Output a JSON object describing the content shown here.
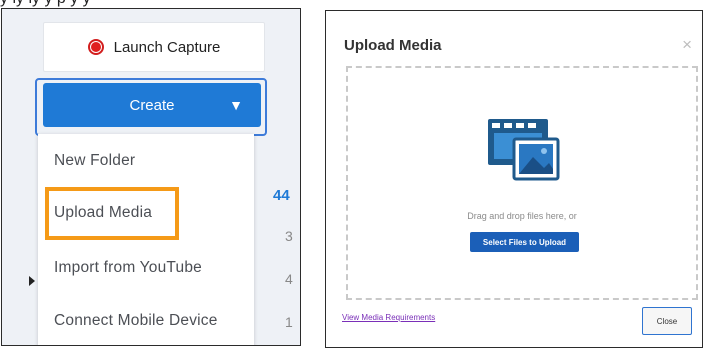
{
  "caption": "y   ly   ly   y                    p      y   y",
  "left_panel": {
    "launch_label": "Launch Capture",
    "create_label": "Create",
    "create_caret": "▼",
    "menu": [
      {
        "label": "New Folder"
      },
      {
        "label": "Upload Media"
      },
      {
        "label": "Import from YouTube"
      },
      {
        "label": "Connect Mobile Device"
      }
    ],
    "counts": [
      "44",
      "3",
      "4",
      "1"
    ]
  },
  "dialog": {
    "title": "Upload Media",
    "close_x": "×",
    "drop_text": "Drag and drop files here, or",
    "select_button": "Select Files to Upload",
    "requirements_link": "View Media Requirements",
    "close_button": "Close"
  },
  "colors": {
    "accent_blue": "#1f7ad6",
    "highlight_orange": "#f59a17",
    "record_red": "#e02020"
  }
}
